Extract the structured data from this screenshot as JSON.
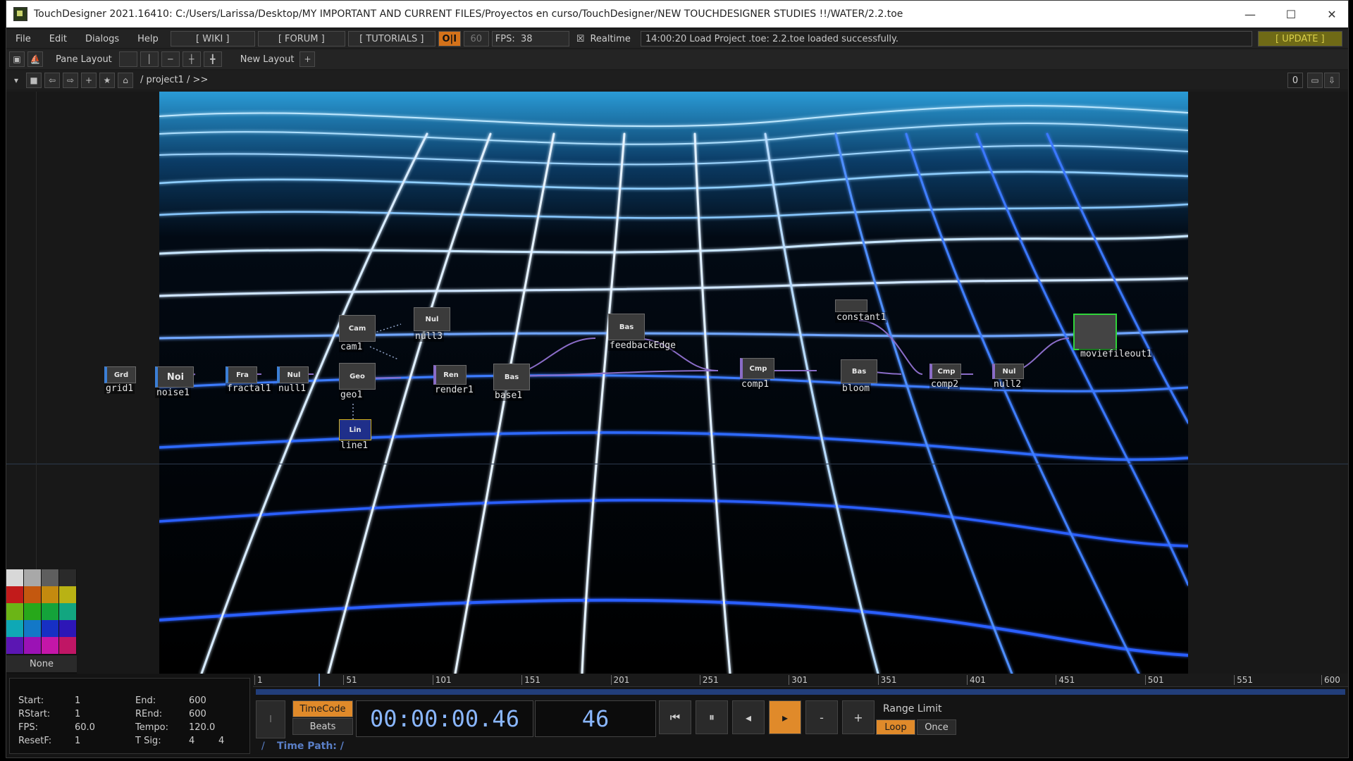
{
  "window": {
    "title": "TouchDesigner 2021.16410: C:/Users/Larissa/Desktop/MY IMPORTANT AND CURRENT FILES/Proyectos en curso/TouchDesigner/NEW TOUCHDESIGNER STUDIES !!/WATER/2.2.toe",
    "controls": {
      "minimize": "—",
      "maximize": "☐",
      "close": "✕"
    }
  },
  "menubar": {
    "items": [
      "File",
      "Edit",
      "Dialogs",
      "Help"
    ],
    "wiki": "[ WIKI ]",
    "forum": "[ FORUM ]",
    "tutorials": "[ TUTORIALS ]",
    "oi": "O|I",
    "fps_cap": "60",
    "fps_label": "FPS:",
    "fps_value": "38",
    "realtime_check": "☒",
    "realtime": "Realtime",
    "status": "14:00:20 Load Project .toe: 2.2.toe loaded successfully.",
    "update": "[ UPDATE ]"
  },
  "toolbar": {
    "pane_layout": "Pane Layout",
    "new_layout": "New Layout",
    "add": "+"
  },
  "pathbar": {
    "path": "/ project1 / >>",
    "right_value": "0"
  },
  "nodes": [
    {
      "id": "grid1",
      "icon": "Grd",
      "label": "grid1"
    },
    {
      "id": "noise1",
      "icon": "Noi",
      "label": "noise1"
    },
    {
      "id": "fractal1",
      "icon": "Fra",
      "label": "fractal1"
    },
    {
      "id": "null1",
      "icon": "Nul",
      "label": "null1"
    },
    {
      "id": "cam1",
      "icon": "Cam",
      "label": "cam1"
    },
    {
      "id": "null3",
      "icon": "Nul",
      "label": "null3"
    },
    {
      "id": "geo1",
      "icon": "Geo",
      "label": "geo1"
    },
    {
      "id": "line1",
      "icon": "Lin",
      "label": "line1"
    },
    {
      "id": "render1",
      "icon": "Ren",
      "label": "render1"
    },
    {
      "id": "base1",
      "icon": "Bas",
      "label": "base1"
    },
    {
      "id": "feedbackEdge",
      "icon": "Bas",
      "label": "feedbackEdge"
    },
    {
      "id": "comp1",
      "icon": "Cmp",
      "label": "comp1"
    },
    {
      "id": "constant1",
      "icon": "",
      "label": "constant1"
    },
    {
      "id": "bloom",
      "icon": "Bas",
      "label": "bloom"
    },
    {
      "id": "comp2",
      "icon": "Cmp",
      "label": "comp2"
    },
    {
      "id": "null2",
      "icon": "Nul",
      "label": "null2"
    },
    {
      "id": "moviefileout1",
      "icon": "",
      "label": "moviefileout1"
    }
  ],
  "palette": {
    "none_label": "None",
    "colors": [
      "#d8d8d8",
      "#a8a8a8",
      "#5e5e5e",
      "#2a2a2a",
      "#c21b1b",
      "#c4580f",
      "#c48a0f",
      "#b9b214",
      "#6bb516",
      "#27a81a",
      "#14a33a",
      "#12a680",
      "#0fa8b5",
      "#1378c7",
      "#1730c4",
      "#2d16b7",
      "#5b16b3",
      "#9b12b5",
      "#c416a8",
      "#c01665"
    ]
  },
  "timeline": {
    "ticks": [
      "1",
      "51",
      "101",
      "151",
      "201",
      "251",
      "301",
      "351",
      "401",
      "451",
      "501",
      "551",
      "600"
    ],
    "info": {
      "start_label": "Start:",
      "start": "1",
      "end_label": "End:",
      "end": "600",
      "rstart_label": "RStart:",
      "rstart": "1",
      "rend_label": "REnd:",
      "rend": "600",
      "fps_label": "FPS:",
      "fps": "60.0",
      "tempo_label": "Tempo:",
      "tempo": "120.0",
      "resetf_label": "ResetF:",
      "resetf": "1",
      "tsig_label": "T Sig:",
      "tsig_a": "4",
      "tsig_b": "4"
    },
    "timecode": "TimeCode",
    "beats": "Beats",
    "time_display": "00:00:00.46",
    "frame_display": "46",
    "range_limit": "Range Limit",
    "loop": "Loop",
    "once": "Once",
    "time_path_label": "Time Path: /",
    "slash": "/",
    "cursor_icon": "I",
    "transport": {
      "to_start": "⏮",
      "pause": "⏸",
      "step_back": "◂",
      "play": "▸",
      "minus": "-",
      "plus": "+"
    }
  }
}
